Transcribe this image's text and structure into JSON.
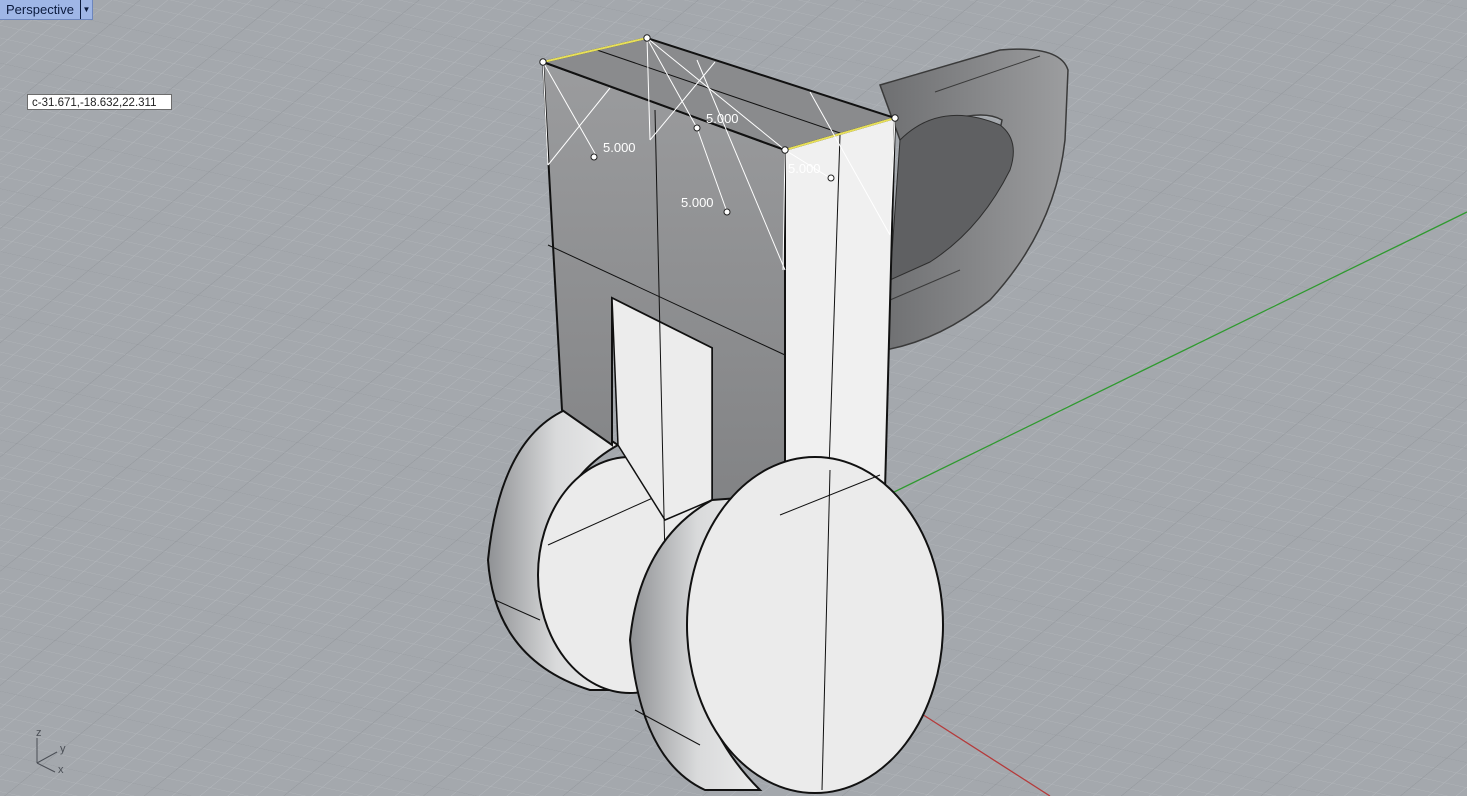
{
  "viewport": {
    "title": "Perspective",
    "menu_icon": "dropdown-arrow-icon",
    "coordinate_readout": "c-31.671,-18.632,22.311"
  },
  "dimensions": [
    "5.000",
    "5.000",
    "5.000",
    "5.000"
  ],
  "axis_gizmo": {
    "z": "z",
    "y": "y",
    "x": "x"
  },
  "colors": {
    "background": "#a4a8ad",
    "grid_minor": "#b4b8bc",
    "grid_major": "#8f9398",
    "y_axis": "#2f9a2f",
    "x_axis": "#b53a3a",
    "selected_edge": "#e8e05a",
    "tab": "#9fb6e6"
  }
}
